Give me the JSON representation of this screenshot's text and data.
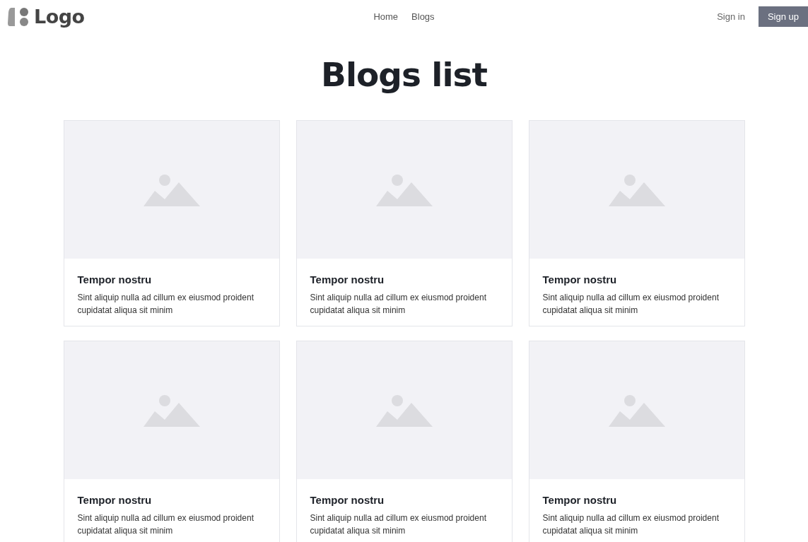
{
  "header": {
    "logo": "Logo",
    "nav": [
      {
        "label": "Home"
      },
      {
        "label": "Blogs"
      }
    ],
    "sign_in": "Sign in",
    "sign_up": "Sign up"
  },
  "title": "Blogs list",
  "posts": [
    {
      "title": "Tempor nostru",
      "excerpt": "Sint aliquip nulla ad cillum ex eiusmod proident cupidatat aliqua sit minim"
    },
    {
      "title": "Tempor nostru",
      "excerpt": "Sint aliquip nulla ad cillum ex eiusmod proident cupidatat aliqua sit minim"
    },
    {
      "title": "Tempor nostru",
      "excerpt": "Sint aliquip nulla ad cillum ex eiusmod proident cupidatat aliqua sit minim"
    },
    {
      "title": "Tempor nostru",
      "excerpt": "Sint aliquip nulla ad cillum ex eiusmod proident cupidatat aliqua sit minim"
    },
    {
      "title": "Tempor nostru",
      "excerpt": "Sint aliquip nulla ad cillum ex eiusmod proident cupidatat aliqua sit minim"
    },
    {
      "title": "Tempor nostru",
      "excerpt": "Sint aliquip nulla ad cillum ex eiusmod proident cupidatat aliqua sit minim"
    }
  ]
}
